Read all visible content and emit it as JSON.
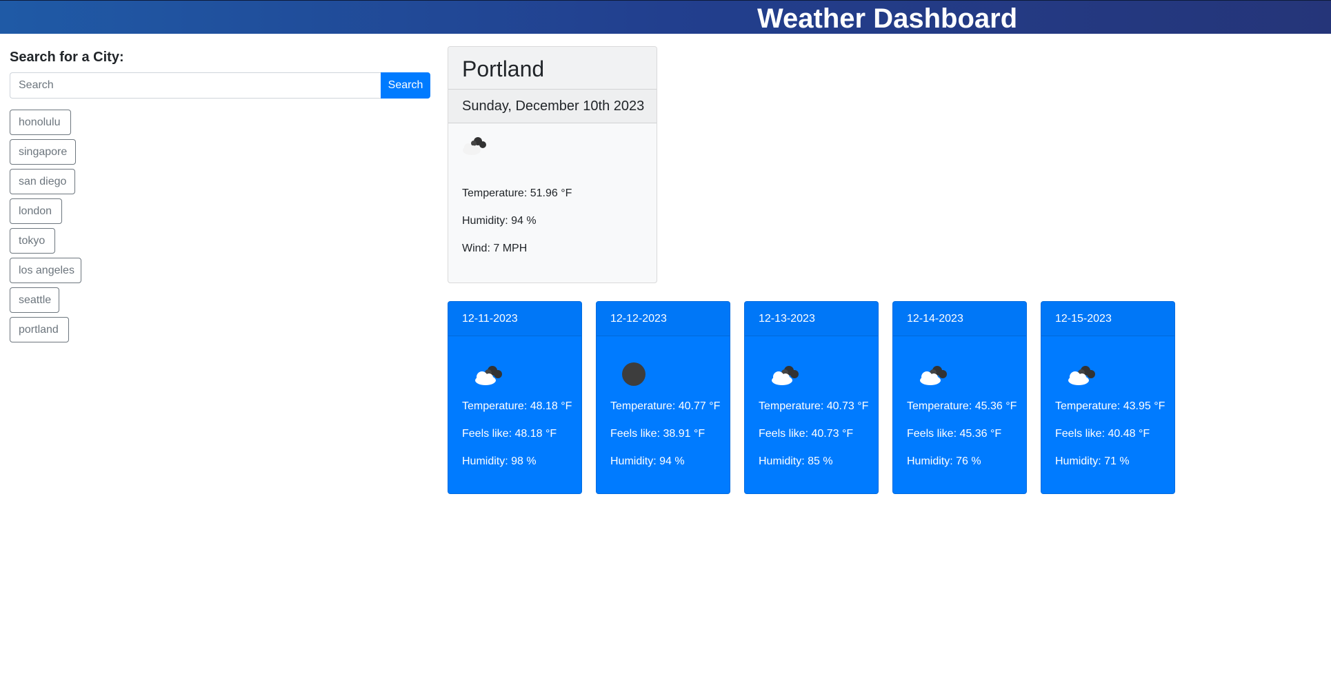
{
  "header": {
    "title": "Weather Dashboard"
  },
  "search": {
    "heading": "Search for a City:",
    "placeholder": "Search",
    "value": "",
    "button_label": "Search",
    "history": [
      "honolulu",
      "singapore",
      "san diego",
      "london",
      "tokyo",
      "los angeles",
      "seattle",
      "portland"
    ]
  },
  "current": {
    "city": "Portland",
    "date": "Sunday, December 10th 2023",
    "icon": "cloud-icon",
    "temperature": "Temperature: 51.96 °F",
    "humidity": "Humidity: 94 %",
    "wind": "Wind: 7 MPH"
  },
  "forecast": [
    {
      "date": "12-11-2023",
      "icon": "cloud-icon",
      "temperature": "Temperature: 48.18 °F",
      "feels_like": "Feels like: 48.18 °F",
      "humidity": "Humidity: 98 %"
    },
    {
      "date": "12-12-2023",
      "icon": "circle-icon",
      "temperature": "Temperature: 40.77 °F",
      "feels_like": "Feels like: 38.91 °F",
      "humidity": "Humidity: 94 %"
    },
    {
      "date": "12-13-2023",
      "icon": "cloud-icon",
      "temperature": "Temperature: 40.73 °F",
      "feels_like": "Feels like: 40.73 °F",
      "humidity": "Humidity: 85 %"
    },
    {
      "date": "12-14-2023",
      "icon": "cloud-icon",
      "temperature": "Temperature: 45.36 °F",
      "feels_like": "Feels like: 45.36 °F",
      "humidity": "Humidity: 76 %"
    },
    {
      "date": "12-15-2023",
      "icon": "cloud-icon",
      "temperature": "Temperature: 43.95 °F",
      "feels_like": "Feels like: 40.48 °F",
      "humidity": "Humidity: 71 %"
    }
  ],
  "colors": {
    "primary": "#007bff",
    "header_start": "#1f5aa6",
    "header_end": "#253579",
    "history_border": "#6c757d"
  }
}
